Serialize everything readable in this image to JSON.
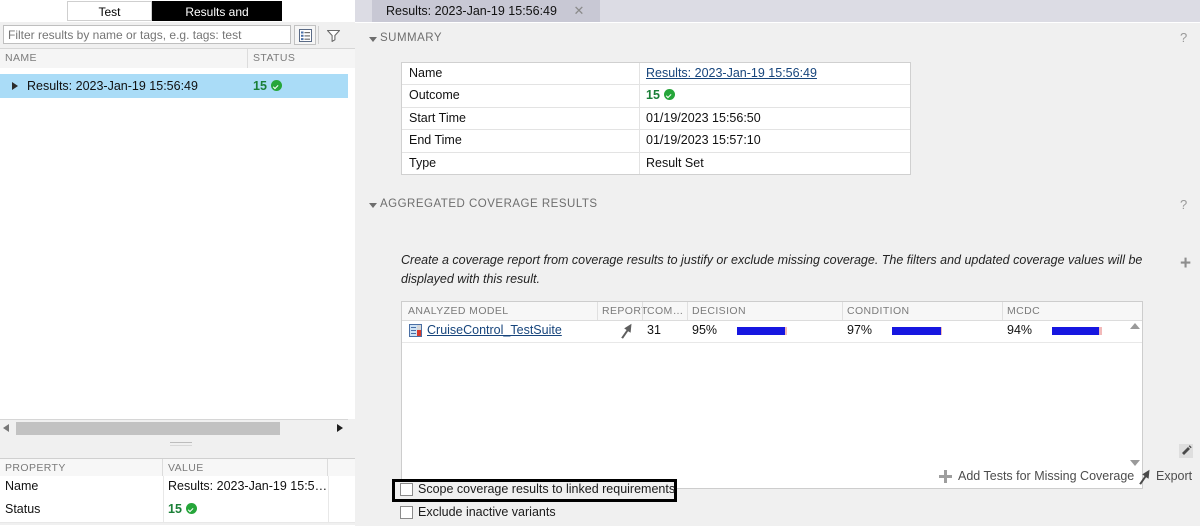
{
  "left": {
    "tabs": [
      {
        "label": "Test Browser",
        "selected": false
      },
      {
        "label": "Results and Artifacts",
        "selected": true
      }
    ],
    "filter": {
      "placeholder": "Filter results by name or tags, e.g. tags: test",
      "value": "",
      "detail_icon": "list-detail-icon",
      "filter_icon": "funnel-icon"
    },
    "tree": {
      "columns": [
        "NAME",
        "STATUS"
      ],
      "rows": [
        {
          "name": "Results: 2023-Jan-19 15:56:49",
          "status": "15",
          "status_icon": "pass-check-icon",
          "expanded": false,
          "selected": true
        }
      ]
    },
    "properties": {
      "columns": [
        "PROPERTY",
        "VALUE"
      ],
      "rows": [
        {
          "key": "Name",
          "value": "Results: 2023-Jan-19 15:5…",
          "green": false
        },
        {
          "key": "Status",
          "value": "15",
          "green": true,
          "icon": "pass-check-icon"
        }
      ]
    }
  },
  "right": {
    "document_tab": {
      "label": "Results: 2023-Jan-19 15:56:49",
      "close_icon": "close-icon"
    },
    "summary": {
      "title": "SUMMARY",
      "help": "?",
      "rows": [
        {
          "key": "Name",
          "value": "Results: 2023-Jan-19 15:56:49",
          "style": "link"
        },
        {
          "key": "Outcome",
          "value": "15",
          "style": "green",
          "icon": "pass-check-icon"
        },
        {
          "key": "Start Time",
          "value": "01/19/2023 15:56:50",
          "style": "plain"
        },
        {
          "key": "End Time",
          "value": "01/19/2023 15:57:10",
          "style": "plain"
        },
        {
          "key": "Type",
          "value": "Result Set",
          "style": "plain"
        }
      ]
    },
    "coverage": {
      "title": "AGGREGATED COVERAGE RESULTS",
      "help": "?",
      "description": "Create a coverage report from coverage results to justify or exclude missing coverage. The filters and updated coverage values will be displayed with this result.",
      "columns": [
        "ANALYZED MODEL",
        "REPORT",
        "COM…",
        "DECISION",
        "CONDITION",
        "MCDC"
      ],
      "add_column_icon": "plus-icon",
      "rows": [
        {
          "model": "CruiseControl_TestSuite",
          "model_icon": "simulink-model-icon",
          "report_icon": "report-flag-icon",
          "complexity": "31",
          "decision": "95%",
          "decision_pct": 95,
          "condition": "97%",
          "condition_pct": 97,
          "mcdc": "94%",
          "mcdc_pct": 94
        }
      ]
    },
    "actions": [
      {
        "label": "Add Tests for Missing Coverage",
        "icon": "plus-icon"
      },
      {
        "label": "Export",
        "icon": "export-flag-icon"
      }
    ],
    "checkboxes": [
      {
        "label": "Scope coverage results to linked requirements",
        "checked": false,
        "focused": true
      },
      {
        "label": "Exclude inactive variants",
        "checked": false,
        "focused": false
      }
    ]
  },
  "colors": {
    "selection_blue": "#aadcf7",
    "pass_green": "#1a7f37",
    "link_blue": "#17457c",
    "bar_covered": "#1616e0",
    "bar_missing": "#f2b9b9",
    "tab_selected_bg": "#000000",
    "panel_bg": "#f0f0f0"
  }
}
